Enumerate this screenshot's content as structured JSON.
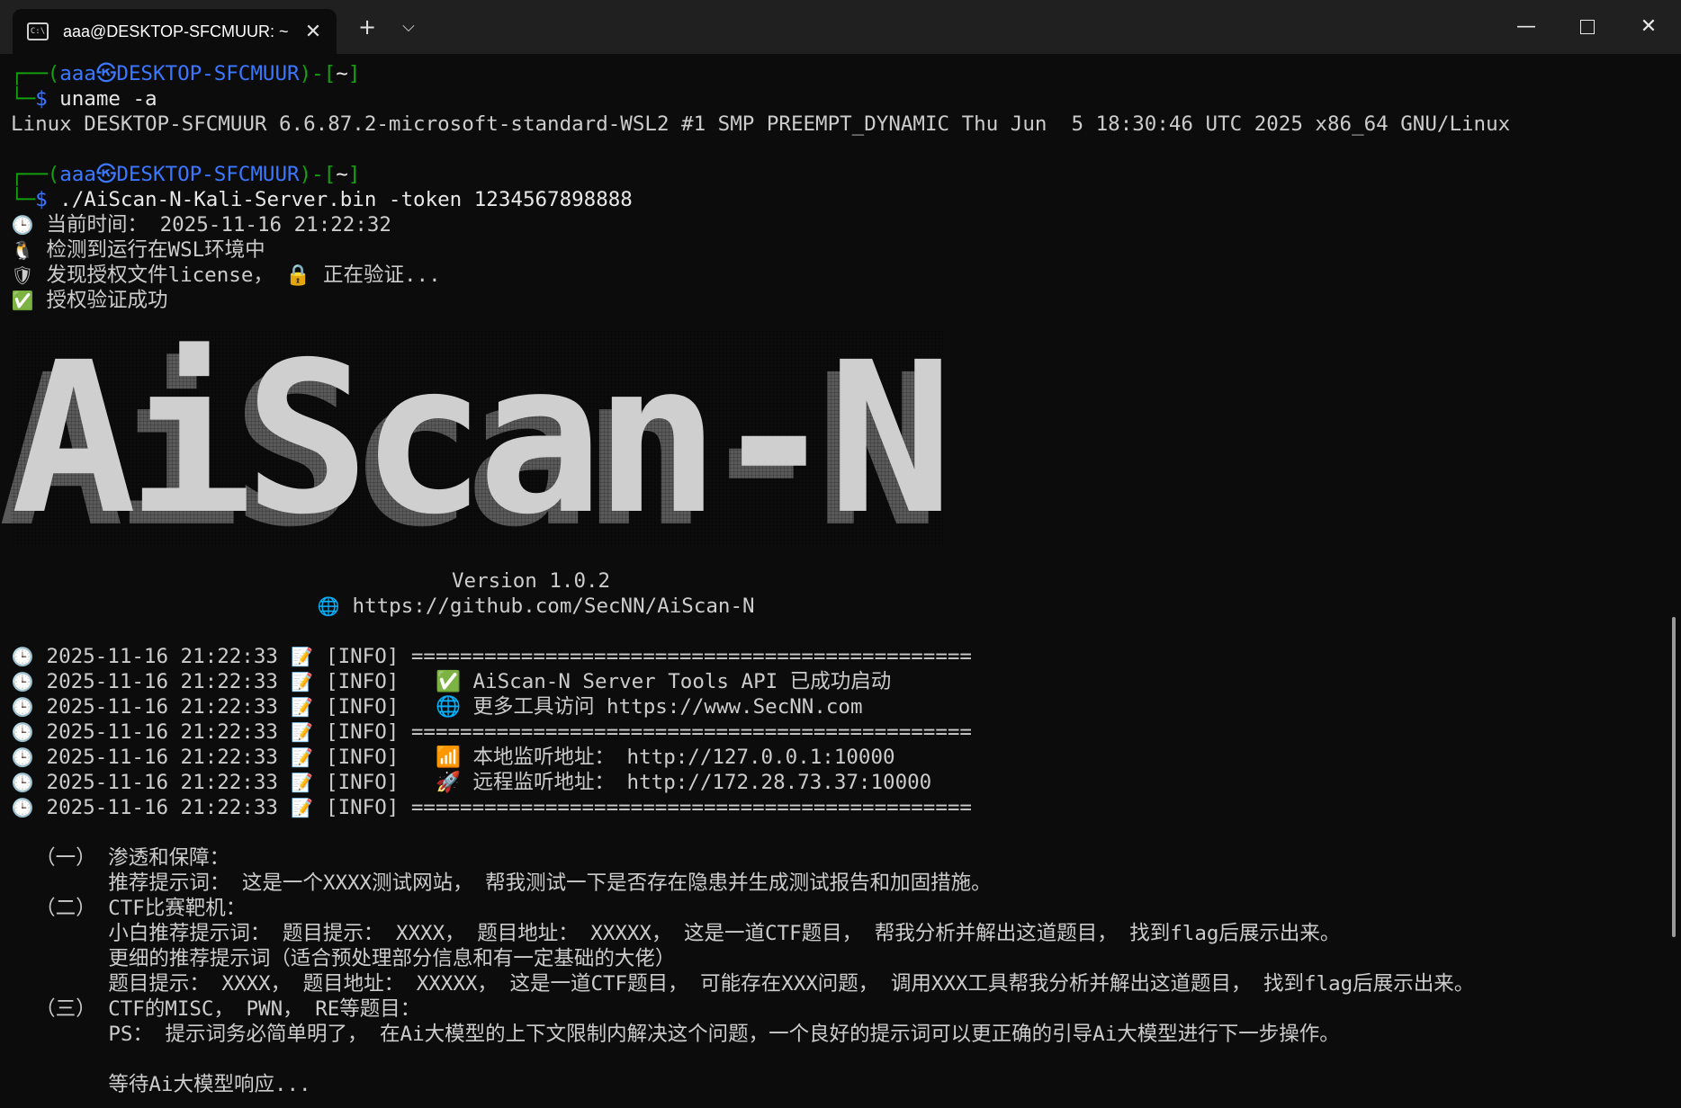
{
  "window": {
    "tab_title": "aaa@DESKTOP-SFCMUUR: ~",
    "new_tab": "+",
    "dropdown": "⌵",
    "close_tab": "✕",
    "minimize": "—",
    "close": "✕"
  },
  "terminal": {
    "prompt": {
      "open": "┌──(",
      "user": "aaa",
      "sep": "㉿",
      "host": "DESKTOP-SFCMUUR",
      "mid": ")-[",
      "dir": "~",
      "close": "]",
      "corner": "└─",
      "dollar": "$"
    },
    "cmd1": " uname -a",
    "out1": "Linux DESKTOP-SFCMUUR 6.6.87.2-microsoft-standard-WSL2 #1 SMP PREEMPT_DYNAMIC Thu Jun  5 18:30:46 UTC 2025 x86_64 GNU/Linux",
    "cmd2": " ./AiScan-N-Kali-Server.bin -token 1234567898888",
    "status": [
      {
        "icon": "🕒",
        "text": " 当前时间： 2025-11-16 21:22:32"
      },
      {
        "icon": "🐧",
        "text": " 检测到运行在WSL环境中"
      },
      {
        "icon": "🛡",
        "text": " 发现授权文件license， 🔒 正在验证..."
      },
      {
        "icon": "✅",
        "text": " 授权验证成功"
      }
    ],
    "banner": "AiScan-N",
    "version": "Version 1.0.2",
    "url_icon": "🌐",
    "url": " https://github.com/SecNN/AiScan-N",
    "logs": [
      {
        "icon": "🕒",
        "ts": " 2025-11-16 21:22:33 ",
        "note": "📝",
        "msg": " [INFO] =============================================="
      },
      {
        "icon": "🕒",
        "ts": " 2025-11-16 21:22:33 ",
        "note": "📝",
        "msg": " [INFO]   ✅ AiScan-N Server Tools API 已成功启动"
      },
      {
        "icon": "🕒",
        "ts": " 2025-11-16 21:22:33 ",
        "note": "📝",
        "msg": " [INFO]   🌐 更多工具访问 https://www.SecNN.com"
      },
      {
        "icon": "🕒",
        "ts": " 2025-11-16 21:22:33 ",
        "note": "📝",
        "msg": " [INFO] =============================================="
      },
      {
        "icon": "🕒",
        "ts": " 2025-11-16 21:22:33 ",
        "note": "📝",
        "msg": " [INFO]   📶 本地监听地址： http://127.0.0.1:10000"
      },
      {
        "icon": "🕒",
        "ts": " 2025-11-16 21:22:33 ",
        "note": "📝",
        "msg": " [INFO]   🚀 远程监听地址： http://172.28.73.37:10000"
      },
      {
        "icon": "🕒",
        "ts": " 2025-11-16 21:22:33 ",
        "note": "📝",
        "msg": " [INFO] =============================================="
      }
    ],
    "guide": [
      "  （一） 渗透和保障：",
      "        推荐提示词： 这是一个XXXX测试网站， 帮我测试一下是否存在隐患并生成测试报告和加固措施。",
      "  （二） CTF比赛靶机：",
      "        小白推荐提示词： 题目提示： XXXX， 题目地址： XXXXX， 这是一道CTF题目， 帮我分析并解出这道题目， 找到flag后展示出来。",
      "        更细的推荐提示词（适合预处理部分信息和有一定基础的大佬）",
      "        题目提示： XXXX， 题目地址： XXXXX， 这是一道CTF题目， 可能存在XXX问题， 调用XXX工具帮我分析并解出这道题目， 找到flag后展示出来。",
      "  （三） CTF的MISC， PWN， RE等题目：",
      "        PS： 提示词务必简单明了， 在Ai大模型的上下文限制内解决这个问题，一个良好的提示词可以更正确的引导Ai大模型进行下一步操作。",
      "",
      "        等待Ai大模型响应..."
    ]
  }
}
